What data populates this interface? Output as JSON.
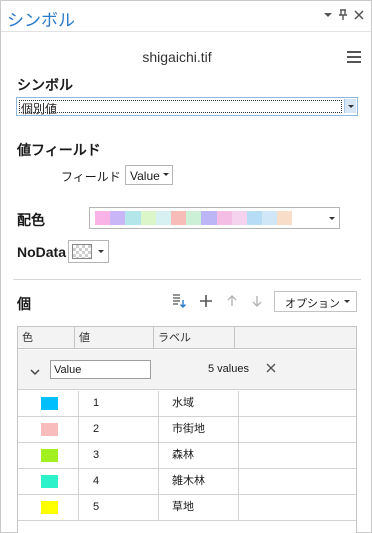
{
  "pane": {
    "title": "シンボル",
    "layer_name": "shigaichi.tif"
  },
  "icons": {
    "dropdown": "chevron-down-icon",
    "pin": "pin-icon",
    "close": "close-icon",
    "menu": "hamburger-menu-icon",
    "add_values": "add-values-icon",
    "add": "plus-icon",
    "move_up": "arrow-up-icon",
    "move_down": "arrow-down-icon",
    "expand": "chevron-down-icon",
    "remove": "close-icon"
  },
  "symbology": {
    "label": "シンボル",
    "selected": "個別値"
  },
  "value_field": {
    "label": "値フィールド",
    "field_label": "フィールド 1",
    "field_value": "Value"
  },
  "color_scheme": {
    "label": "配色",
    "colors": [
      "#f9b3e6",
      "#c9b6f6",
      "#b3e6ea",
      "#dbf7c9",
      "#d7f0f2",
      "#f8bcb8",
      "#ccf0d6",
      "#bcb6f6",
      "#f4bde6",
      "#f5d3ee",
      "#b6dcf6",
      "#cfe7f7",
      "#f8ddc9"
    ]
  },
  "nodata": {
    "label": "NoData"
  },
  "classes": {
    "label": "個",
    "options_label": "オプション",
    "headers": [
      "色",
      "値",
      "ラベル"
    ],
    "group": {
      "field": "Value",
      "count": "5 values"
    },
    "rows": [
      {
        "value": "1",
        "label": "水域",
        "color": "#00bfff"
      },
      {
        "value": "2",
        "label": "市街地",
        "color": "#f9bcbc"
      },
      {
        "value": "3",
        "label": "森林",
        "color": "#a2f01f"
      },
      {
        "value": "4",
        "label": "雑木林",
        "color": "#2bf2c9"
      },
      {
        "value": "5",
        "label": "草地",
        "color": "#ffff00"
      }
    ]
  }
}
